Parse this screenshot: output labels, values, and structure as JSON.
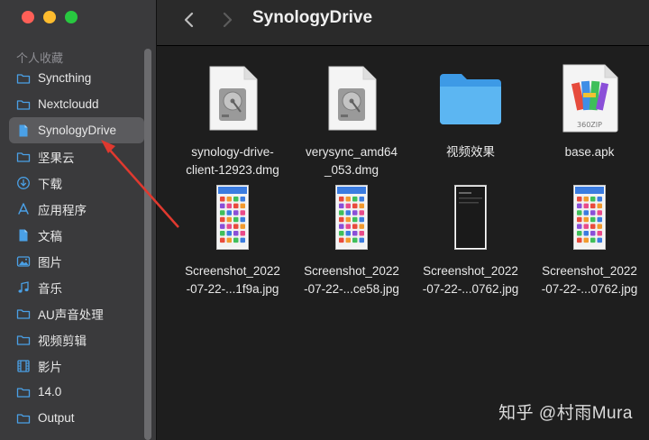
{
  "window": {
    "title": "SynologyDrive"
  },
  "sidebar": {
    "section_label": "个人收藏",
    "items": [
      {
        "label": "Syncthing",
        "icon": "folder-icon"
      },
      {
        "label": "Nextcloudd",
        "icon": "folder-icon"
      },
      {
        "label": "SynologyDrive",
        "icon": "document-icon",
        "selected": true
      },
      {
        "label": "坚果云",
        "icon": "folder-icon"
      },
      {
        "label": "下载",
        "icon": "download-icon"
      },
      {
        "label": "应用程序",
        "icon": "applications-icon"
      },
      {
        "label": "文稿",
        "icon": "document-icon"
      },
      {
        "label": "图片",
        "icon": "photo-icon"
      },
      {
        "label": "音乐",
        "icon": "music-icon"
      },
      {
        "label": "AU声音处理",
        "icon": "folder-icon"
      },
      {
        "label": "视频剪辑",
        "icon": "folder-icon"
      },
      {
        "label": "影片",
        "icon": "film-icon"
      },
      {
        "label": "14.0",
        "icon": "folder-icon"
      },
      {
        "label": "Output",
        "icon": "folder-icon"
      }
    ]
  },
  "files": [
    {
      "name": "synology-drive-\nclient-12923.dmg",
      "type": "dmg"
    },
    {
      "name": "verysync_amd64\n_053.dmg",
      "type": "dmg"
    },
    {
      "name": "视频效果",
      "type": "folder"
    },
    {
      "name": "base.apk",
      "type": "apk",
      "badge": "360ZIP"
    },
    {
      "name": "Screenshot_2022\n-07-22-...1f9a.jpg",
      "type": "screenshot"
    },
    {
      "name": "Screenshot_2022\n-07-22-...ce58.jpg",
      "type": "screenshot"
    },
    {
      "name": "Screenshot_2022\n-07-22-...0762.jpg",
      "type": "screenshot-dark"
    },
    {
      "name": "Screenshot_2022\n-07-22-...0762.jpg",
      "type": "screenshot"
    }
  ],
  "watermark": "知乎 @村雨Mura",
  "colors": {
    "sidebar_bg": "#3a3a3c",
    "selected_bg": "#5b5b5e",
    "content_bg": "#1e1e1e",
    "folder_blue": "#4aa8ea",
    "annotation_arrow": "#e0392f"
  }
}
